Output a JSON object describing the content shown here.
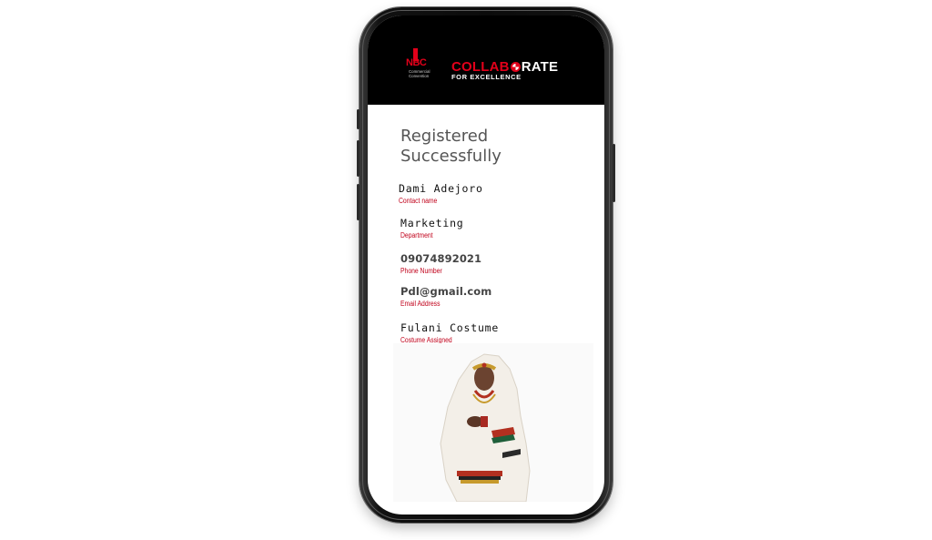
{
  "brand": {
    "nbc_logo_text": "NBC",
    "nbc_logo_subtext": "Commercial Convention",
    "campaign_title_part1": "COLLAB",
    "campaign_title_part2": "RATE",
    "campaign_subtitle": "FOR EXCELLENCE",
    "colors": {
      "accent_red": "#e2001a",
      "header_bg": "#000000",
      "label_red": "#c0001a"
    }
  },
  "page": {
    "title": "Registered Successfully"
  },
  "fields": [
    {
      "value": "Dami Adejoro",
      "label": "Contact name"
    },
    {
      "value": "Marketing",
      "label": "Department"
    },
    {
      "value": "09074892021",
      "label": "Phone Number"
    },
    {
      "value": "Pdl@gmail.com",
      "label": "Email Address"
    },
    {
      "value": "Fulani Costume",
      "label": "Costume Assigned"
    }
  ],
  "costume_image": {
    "icon": "costume-photo"
  }
}
